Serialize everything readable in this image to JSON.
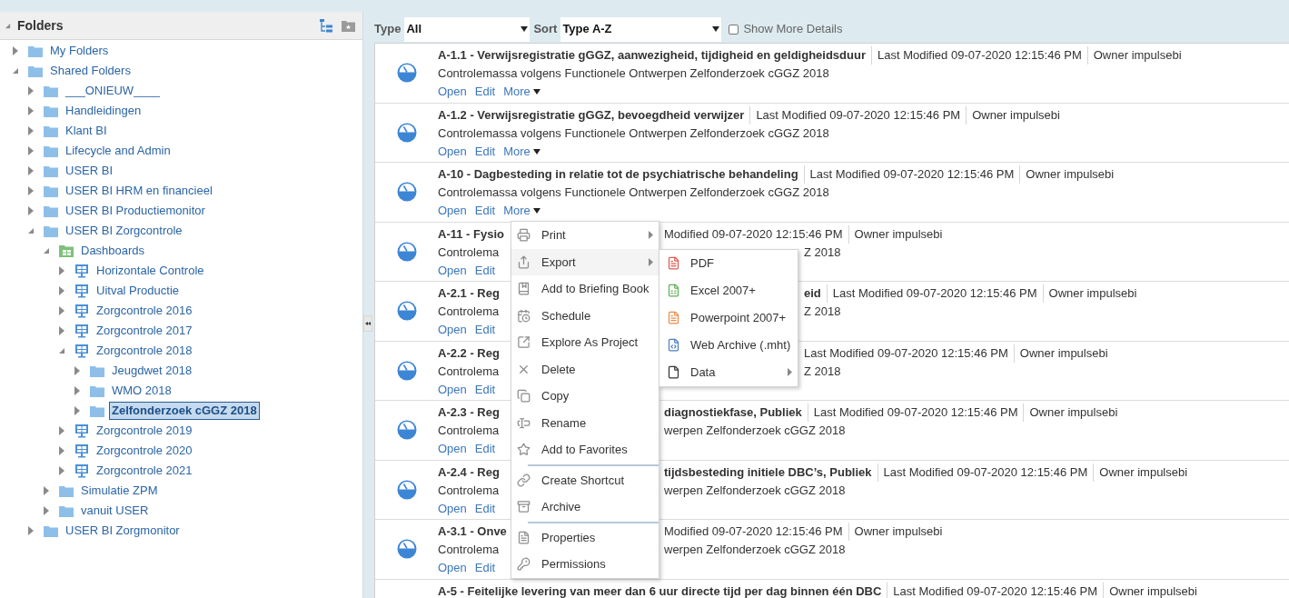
{
  "folders_panel": {
    "title": "Folders",
    "expanded": true
  },
  "tree": [
    {
      "label": "My Folders",
      "kind": "folder",
      "expanded": false,
      "selected": false
    },
    {
      "label": "Shared Folders",
      "kind": "folder",
      "expanded": true,
      "selected": false,
      "children": [
        {
          "label": "___ONIEUW____",
          "kind": "folder",
          "expanded": false,
          "selected": false
        },
        {
          "label": "Handleidingen",
          "kind": "folder",
          "expanded": false,
          "selected": false
        },
        {
          "label": "Klant BI",
          "kind": "folder",
          "expanded": false,
          "selected": false
        },
        {
          "label": "Lifecycle and Admin",
          "kind": "folder",
          "expanded": false,
          "selected": false
        },
        {
          "label": "USER BI",
          "kind": "folder",
          "expanded": false,
          "selected": false
        },
        {
          "label": "USER BI HRM en financieel",
          "kind": "folder",
          "expanded": false,
          "selected": false
        },
        {
          "label": "USER BI Productiemonitor",
          "kind": "folder",
          "expanded": false,
          "selected": false
        },
        {
          "label": "USER BI Zorgcontrole",
          "kind": "folder",
          "expanded": true,
          "selected": false,
          "children": [
            {
              "label": "Dashboards",
              "kind": "dashboards",
              "expanded": true,
              "selected": false,
              "children": [
                {
                  "label": "Horizontale Controle",
                  "kind": "dashboard",
                  "expanded": false,
                  "selected": false
                },
                {
                  "label": "Uitval Productie",
                  "kind": "dashboard",
                  "expanded": false,
                  "selected": false
                },
                {
                  "label": "Zorgcontrole 2016",
                  "kind": "dashboard",
                  "expanded": false,
                  "selected": false
                },
                {
                  "label": "Zorgcontrole 2017",
                  "kind": "dashboard",
                  "expanded": false,
                  "selected": false
                },
                {
                  "label": "Zorgcontrole 2018",
                  "kind": "dashboard",
                  "expanded": true,
                  "selected": false,
                  "children": [
                    {
                      "label": "Jeugdwet 2018",
                      "kind": "folder",
                      "expanded": false,
                      "selected": false
                    },
                    {
                      "label": "WMO 2018",
                      "kind": "folder",
                      "expanded": false,
                      "selected": false
                    },
                    {
                      "label": "Zelfonderzoek cGGZ 2018",
                      "kind": "folder",
                      "expanded": false,
                      "selected": true
                    }
                  ]
                },
                {
                  "label": "Zorgcontrole 2019",
                  "kind": "dashboard",
                  "expanded": false,
                  "selected": false
                },
                {
                  "label": "Zorgcontrole 2020",
                  "kind": "dashboard",
                  "expanded": false,
                  "selected": false
                },
                {
                  "label": "Zorgcontrole 2021",
                  "kind": "dashboard",
                  "expanded": false,
                  "selected": false
                }
              ]
            },
            {
              "label": "Simulatie ZPM",
              "kind": "folder",
              "expanded": false,
              "selected": false
            },
            {
              "label": "vanuit USER",
              "kind": "folder",
              "expanded": false,
              "selected": false
            }
          ]
        },
        {
          "label": "USER BI Zorgmonitor",
          "kind": "folder",
          "expanded": false,
          "selected": false
        }
      ]
    }
  ],
  "filters": {
    "type_label": "Type",
    "type_value": "All",
    "sort_label": "Sort",
    "sort_value": "Type A-Z",
    "details": {
      "label": "Show More Details",
      "checked": false
    }
  },
  "items": [
    {
      "line1": {
        "head": [
          {
            "kind": "title",
            "text": "A-1.1 - Verwijsregistratie gGGZ, aanwezigheid, tijdigheid en geldigheidsduur"
          },
          {
            "kind": "meta",
            "text": "Last Modified 09-07-2020 12:15:46 PM"
          },
          {
            "kind": "meta",
            "text": "Owner impulsebi"
          }
        ]
      },
      "line2": {
        "head": "Controlemassa volgens Functionele Ontwerpen Zelfonderzoek cGGZ 2018"
      },
      "actions": [
        {
          "kind": "link",
          "label": "Open"
        },
        {
          "kind": "link",
          "label": "Edit"
        },
        {
          "kind": "dropdown",
          "label": "More"
        }
      ]
    },
    {
      "line1": {
        "head": [
          {
            "kind": "title",
            "text": "A-1.2 - Verwijsregistratie gGGZ, bevoegdheid verwijzer"
          },
          {
            "kind": "meta",
            "text": "Last Modified 09-07-2020 12:15:46 PM"
          },
          {
            "kind": "meta",
            "text": "Owner impulsebi"
          }
        ]
      },
      "line2": {
        "head": "Controlemassa volgens Functionele Ontwerpen Zelfonderzoek cGGZ 2018"
      },
      "actions": [
        {
          "kind": "link",
          "label": "Open"
        },
        {
          "kind": "link",
          "label": "Edit"
        },
        {
          "kind": "dropdown",
          "label": "More"
        }
      ]
    },
    {
      "line1": {
        "head": [
          {
            "kind": "title",
            "text": "A-10 - Dagbesteding in relatie tot de psychiatrische behandeling"
          },
          {
            "kind": "meta",
            "text": "Last Modified 09-07-2020 12:15:46 PM"
          },
          {
            "kind": "meta",
            "text": "Owner impulsebi"
          }
        ]
      },
      "line2": {
        "head": "Controlemassa volgens Functionele Ontwerpen Zelfonderzoek cGGZ 2018"
      },
      "actions": [
        {
          "kind": "link",
          "label": "Open"
        },
        {
          "kind": "link",
          "label": "Edit"
        },
        {
          "kind": "dropdown",
          "label": "More"
        }
      ]
    },
    {
      "line1": {
        "head": [
          {
            "kind": "title",
            "text": "A-11 - Fysio"
          }
        ],
        "tail": [
          {
            "kind": "meta",
            "text": "Modified 09-07-2020 12:15:46 PM"
          },
          {
            "kind": "meta",
            "text": "Owner impulsebi"
          }
        ]
      },
      "line2": {
        "head": "Controlema",
        "tail": "Z 2018"
      },
      "actions": [
        {
          "kind": "link",
          "label": "Open"
        },
        {
          "kind": "link",
          "label": "Edit"
        }
      ]
    },
    {
      "line1": {
        "head": [
          {
            "kind": "title",
            "text": "A-2.1 - Reg"
          }
        ],
        "tail": [
          {
            "kind": "title",
            "text": "eid"
          },
          {
            "kind": "meta",
            "text": "Last Modified 09-07-2020 12:15:46 PM"
          },
          {
            "kind": "meta",
            "text": "Owner impulsebi"
          }
        ]
      },
      "line2": {
        "head": "Controlema",
        "tail": "Z 2018"
      },
      "actions": [
        {
          "kind": "link",
          "label": "Open"
        },
        {
          "kind": "link",
          "label": "Edit"
        }
      ]
    },
    {
      "line1": {
        "head": [
          {
            "kind": "title",
            "text": "A-2.2 - Reg"
          }
        ],
        "tail": [
          {
            "kind": "meta",
            "text": "Last Modified 09-07-2020 12:15:46 PM"
          },
          {
            "kind": "meta",
            "text": "Owner impulsebi"
          }
        ]
      },
      "line2": {
        "head": "Controlema",
        "tail": "Z 2018"
      },
      "actions": [
        {
          "kind": "link",
          "label": "Open"
        },
        {
          "kind": "link",
          "label": "Edit"
        }
      ]
    },
    {
      "line1": {
        "head": [
          {
            "kind": "title",
            "text": "A-2.3 - Reg"
          }
        ],
        "tail": [
          {
            "kind": "title",
            "text": "diagnostiekfase, Publiek"
          },
          {
            "kind": "meta",
            "text": "Last Modified 09-07-2020 12:15:46 PM"
          },
          {
            "kind": "meta",
            "text": "Owner impulsebi"
          }
        ]
      },
      "line2": {
        "head": "Controlema",
        "tail": "werpen Zelfonderzoek cGGZ 2018"
      },
      "actions": [
        {
          "kind": "link",
          "label": "Open"
        },
        {
          "kind": "link",
          "label": "Edit"
        }
      ]
    },
    {
      "line1": {
        "head": [
          {
            "kind": "title",
            "text": "A-2.4 - Reg"
          }
        ],
        "tail": [
          {
            "kind": "title",
            "text": "tijdsbesteding initiele DBC’s, Publiek"
          },
          {
            "kind": "meta",
            "text": "Last Modified 09-07-2020 12:15:46 PM"
          },
          {
            "kind": "meta",
            "text": "Owner impulsebi"
          }
        ]
      },
      "line2": {
        "head": "Controlema",
        "tail": "werpen Zelfonderzoek cGGZ 2018"
      },
      "actions": [
        {
          "kind": "link",
          "label": "Open"
        },
        {
          "kind": "link",
          "label": "Edit"
        }
      ]
    },
    {
      "line1": {
        "head": [
          {
            "kind": "title",
            "text": "A-3.1 - Onve"
          }
        ],
        "tail": [
          {
            "kind": "meta",
            "text": "Modified 09-07-2020 12:15:46 PM"
          },
          {
            "kind": "meta",
            "text": "Owner impulsebi"
          }
        ]
      },
      "line2": {
        "head": "Controlema",
        "tail": "werpen Zelfonderzoek cGGZ 2018"
      },
      "actions": [
        {
          "kind": "link",
          "label": "Open"
        },
        {
          "kind": "link",
          "label": "Edit"
        }
      ]
    },
    {
      "line1": {
        "head": [
          {
            "kind": "title",
            "text": "A-5 - Feitelijke levering van meer dan 6 uur directe tijd per dag binnen één DBC"
          },
          {
            "kind": "meta",
            "text": "Last Modified 09-07-2020 12:15:46 PM"
          },
          {
            "kind": "meta",
            "text": "Owner impulsebi"
          }
        ]
      }
    }
  ],
  "context_menu": {
    "items": [
      {
        "kind": "item",
        "label": "Print",
        "has_submenu": true,
        "expanded": false
      },
      {
        "kind": "item",
        "label": "Export",
        "has_submenu": true,
        "expanded": true,
        "children": [
          {
            "label": "PDF",
            "has_submenu": false
          },
          {
            "label": "Excel 2007+",
            "has_submenu": false
          },
          {
            "label": "Powerpoint 2007+",
            "has_submenu": false
          },
          {
            "label": "Web Archive (.mht)",
            "has_submenu": false
          },
          {
            "label": "Data",
            "has_submenu": true
          }
        ]
      },
      {
        "kind": "item",
        "label": "Add to Briefing Book",
        "has_submenu": false
      },
      {
        "kind": "item",
        "label": "Schedule",
        "has_submenu": false
      },
      {
        "kind": "item",
        "label": "Explore As Project",
        "has_submenu": false
      },
      {
        "kind": "item",
        "label": "Delete",
        "has_submenu": false
      },
      {
        "kind": "item",
        "label": "Copy",
        "has_submenu": false
      },
      {
        "kind": "item",
        "label": "Rename",
        "has_submenu": false
      },
      {
        "kind": "item",
        "label": "Add to Favorites",
        "has_submenu": false
      },
      {
        "kind": "separator"
      },
      {
        "kind": "item",
        "label": "Create Shortcut",
        "has_submenu": false
      },
      {
        "kind": "item",
        "label": "Archive",
        "has_submenu": false
      },
      {
        "kind": "separator"
      },
      {
        "kind": "item",
        "label": "Properties",
        "has_submenu": false
      },
      {
        "kind": "item",
        "label": "Permissions",
        "has_submenu": false
      }
    ]
  }
}
